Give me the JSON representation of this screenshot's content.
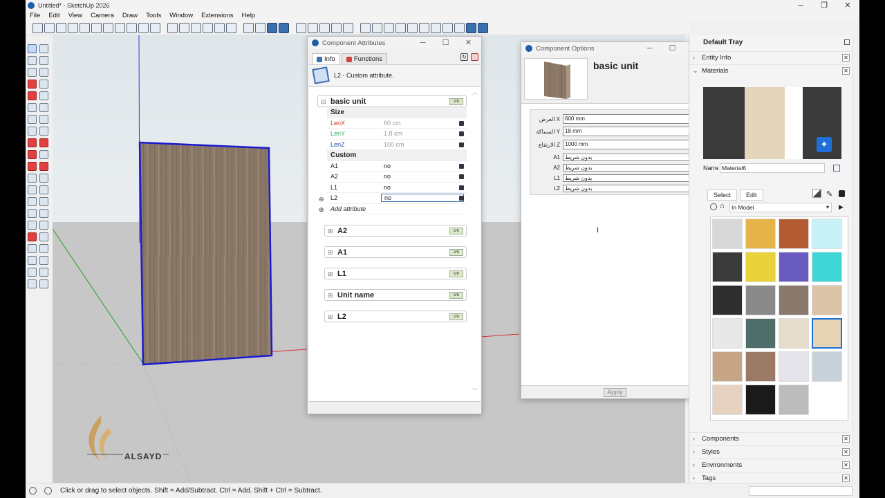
{
  "app": {
    "title": "Untitled* - SketchUp 2026",
    "menus": [
      "File",
      "Edit",
      "View",
      "Camera",
      "Draw",
      "Tools",
      "Window",
      "Extensions",
      "Help"
    ],
    "status": "Click or drag to select objects. Shift = Add/Subtract. Ctrl = Add. Shift + Ctrl = Subtract.",
    "watermark": "ALSAYD"
  },
  "component_attributes": {
    "window_title": "Component Attributes",
    "tabs": [
      "Info",
      "Functions"
    ],
    "header_text": "L2 - Custom attribute.",
    "groups": [
      {
        "name": "basic unit",
        "unit": "cm"
      },
      {
        "name": "A2",
        "unit": "cm"
      },
      {
        "name": "A1",
        "unit": "cm"
      },
      {
        "name": "L1",
        "unit": "cm"
      },
      {
        "name": "Unit name",
        "unit": "cm"
      },
      {
        "name": "L2",
        "unit": "cm"
      }
    ],
    "size_label": "Size",
    "custom_label": "Custom",
    "add_attribute": "Add attribute",
    "size_rows": [
      {
        "name": "LenX",
        "value": "60 cm",
        "color": "#c0392b"
      },
      {
        "name": "LenY",
        "value": "1.8 cm",
        "color": "#27ae60"
      },
      {
        "name": "LenZ",
        "value": "100 cm",
        "color": "#1f4fa8"
      }
    ],
    "custom_rows": [
      {
        "name": "A1",
        "value": "no"
      },
      {
        "name": "A2",
        "value": "no"
      },
      {
        "name": "L1",
        "value": "no"
      },
      {
        "name": "L2",
        "value": "no"
      }
    ]
  },
  "component_options": {
    "window_title": "Component Options",
    "title": "basic unit",
    "rows": [
      {
        "label": "العرض X",
        "value": "600 mm"
      },
      {
        "label": "السماكة Y",
        "value": "18 mm"
      },
      {
        "label": "الارتفاع Z",
        "value": "1000 mm"
      },
      {
        "label": "A1",
        "value": "بدون شريط"
      },
      {
        "label": "A2",
        "value": "بدون شريط"
      },
      {
        "label": "L1",
        "value": "بدون شريط"
      },
      {
        "label": "L2",
        "value": "بدون شريط"
      }
    ],
    "apply": "Apply"
  },
  "tray": {
    "title": "Default Tray",
    "entity_info": "Entity Info",
    "materials": "Materials",
    "name_label": "Name",
    "material_name": "Material6",
    "tab_select": "Select",
    "tab_edit": "Edit",
    "collection": "In Model",
    "panels": [
      "Components",
      "Styles",
      "Environments",
      "Tags"
    ],
    "swatch_colors": [
      "#d8d8d8",
      "#e6b24a",
      "#b35b32",
      "#c8f2f6",
      "#3a3a3a",
      "#e8d43a",
      "#6a5bc0",
      "#3ed6d6",
      "#2e2e2e",
      "#8a8a8a",
      "#8a7a6e",
      "#d9c4a8",
      "#e8e8e8",
      "#4e6e6a",
      "#e6dccb",
      "#e6d4b4",
      "#c6a486",
      "#9a7a64",
      "#e4e4ea",
      "#c8d0d8",
      "#e6d2c0",
      "#1a1a1a",
      "#bcbcbc"
    ]
  }
}
